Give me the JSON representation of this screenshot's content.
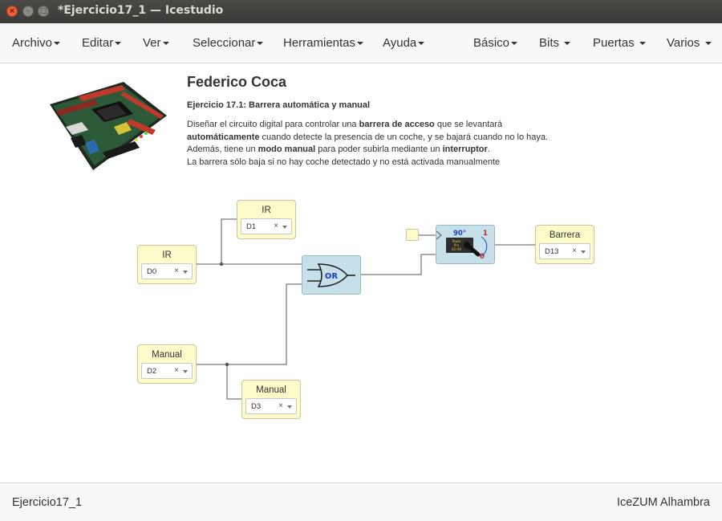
{
  "window": {
    "title": "*Ejercicio17_1 — Icestudio"
  },
  "menu": {
    "left": [
      "Archivo",
      "Editar",
      "Ver",
      "Seleccionar",
      "Herramientas",
      "Ayuda"
    ],
    "right": [
      "Básico",
      "Bits",
      "Puertas",
      "Varios"
    ]
  },
  "info": {
    "author": "Federico Coca",
    "subtitle_bold": "Ejercicio 17.1",
    "subtitle_rest": ": Barrera automática y manual",
    "line1_a": "Diseñar el circuito digital para controlar una ",
    "line1_b": "barrera de acceso",
    "line1_c": " que se levantará",
    "line2_a": "automáticamente",
    "line2_b": " cuando detecte la presencia de un coche, y se bajará cuando no lo haya.",
    "line3_a": "Además, tiene un ",
    "line3_b": "modo manual",
    "line3_c": " para poder subirla mediante un ",
    "line3_d": "interruptor",
    "line3_e": ".",
    "line4": "La barrera sólo baja si no hay coche detectado y no está activada manualmente"
  },
  "blocks": {
    "ir_d1": {
      "label": "IR",
      "pin": "D1"
    },
    "ir_d0": {
      "label": "IR",
      "pin": "D0"
    },
    "manual_d2": {
      "label": "Manual",
      "pin": "D2"
    },
    "manual_d3": {
      "label": "Manual",
      "pin": "D3"
    },
    "barrera": {
      "label": "Barrera",
      "pin": "D13"
    },
    "or_gate": {
      "label": "OR"
    },
    "servo": {
      "angle": "90°",
      "one": "1",
      "zero": "0",
      "brand_line1": "Tower",
      "brand_line2": "Pro",
      "brand_line3": "SG-90"
    }
  },
  "select_clear": "×",
  "footer": {
    "left": "Ejercicio17_1",
    "right": "IceZUM Alhambra"
  },
  "colors": {
    "block_yellow": "#fdfbc9",
    "block_blue": "#c6e0ea",
    "wire": "#555555",
    "titlebar": "#3c3b37"
  },
  "icons": [
    "close-icon",
    "minimize-icon",
    "maximize-icon",
    "caret-down-icon",
    "fpga-board-image",
    "servo-icon",
    "or-gate-icon"
  ]
}
